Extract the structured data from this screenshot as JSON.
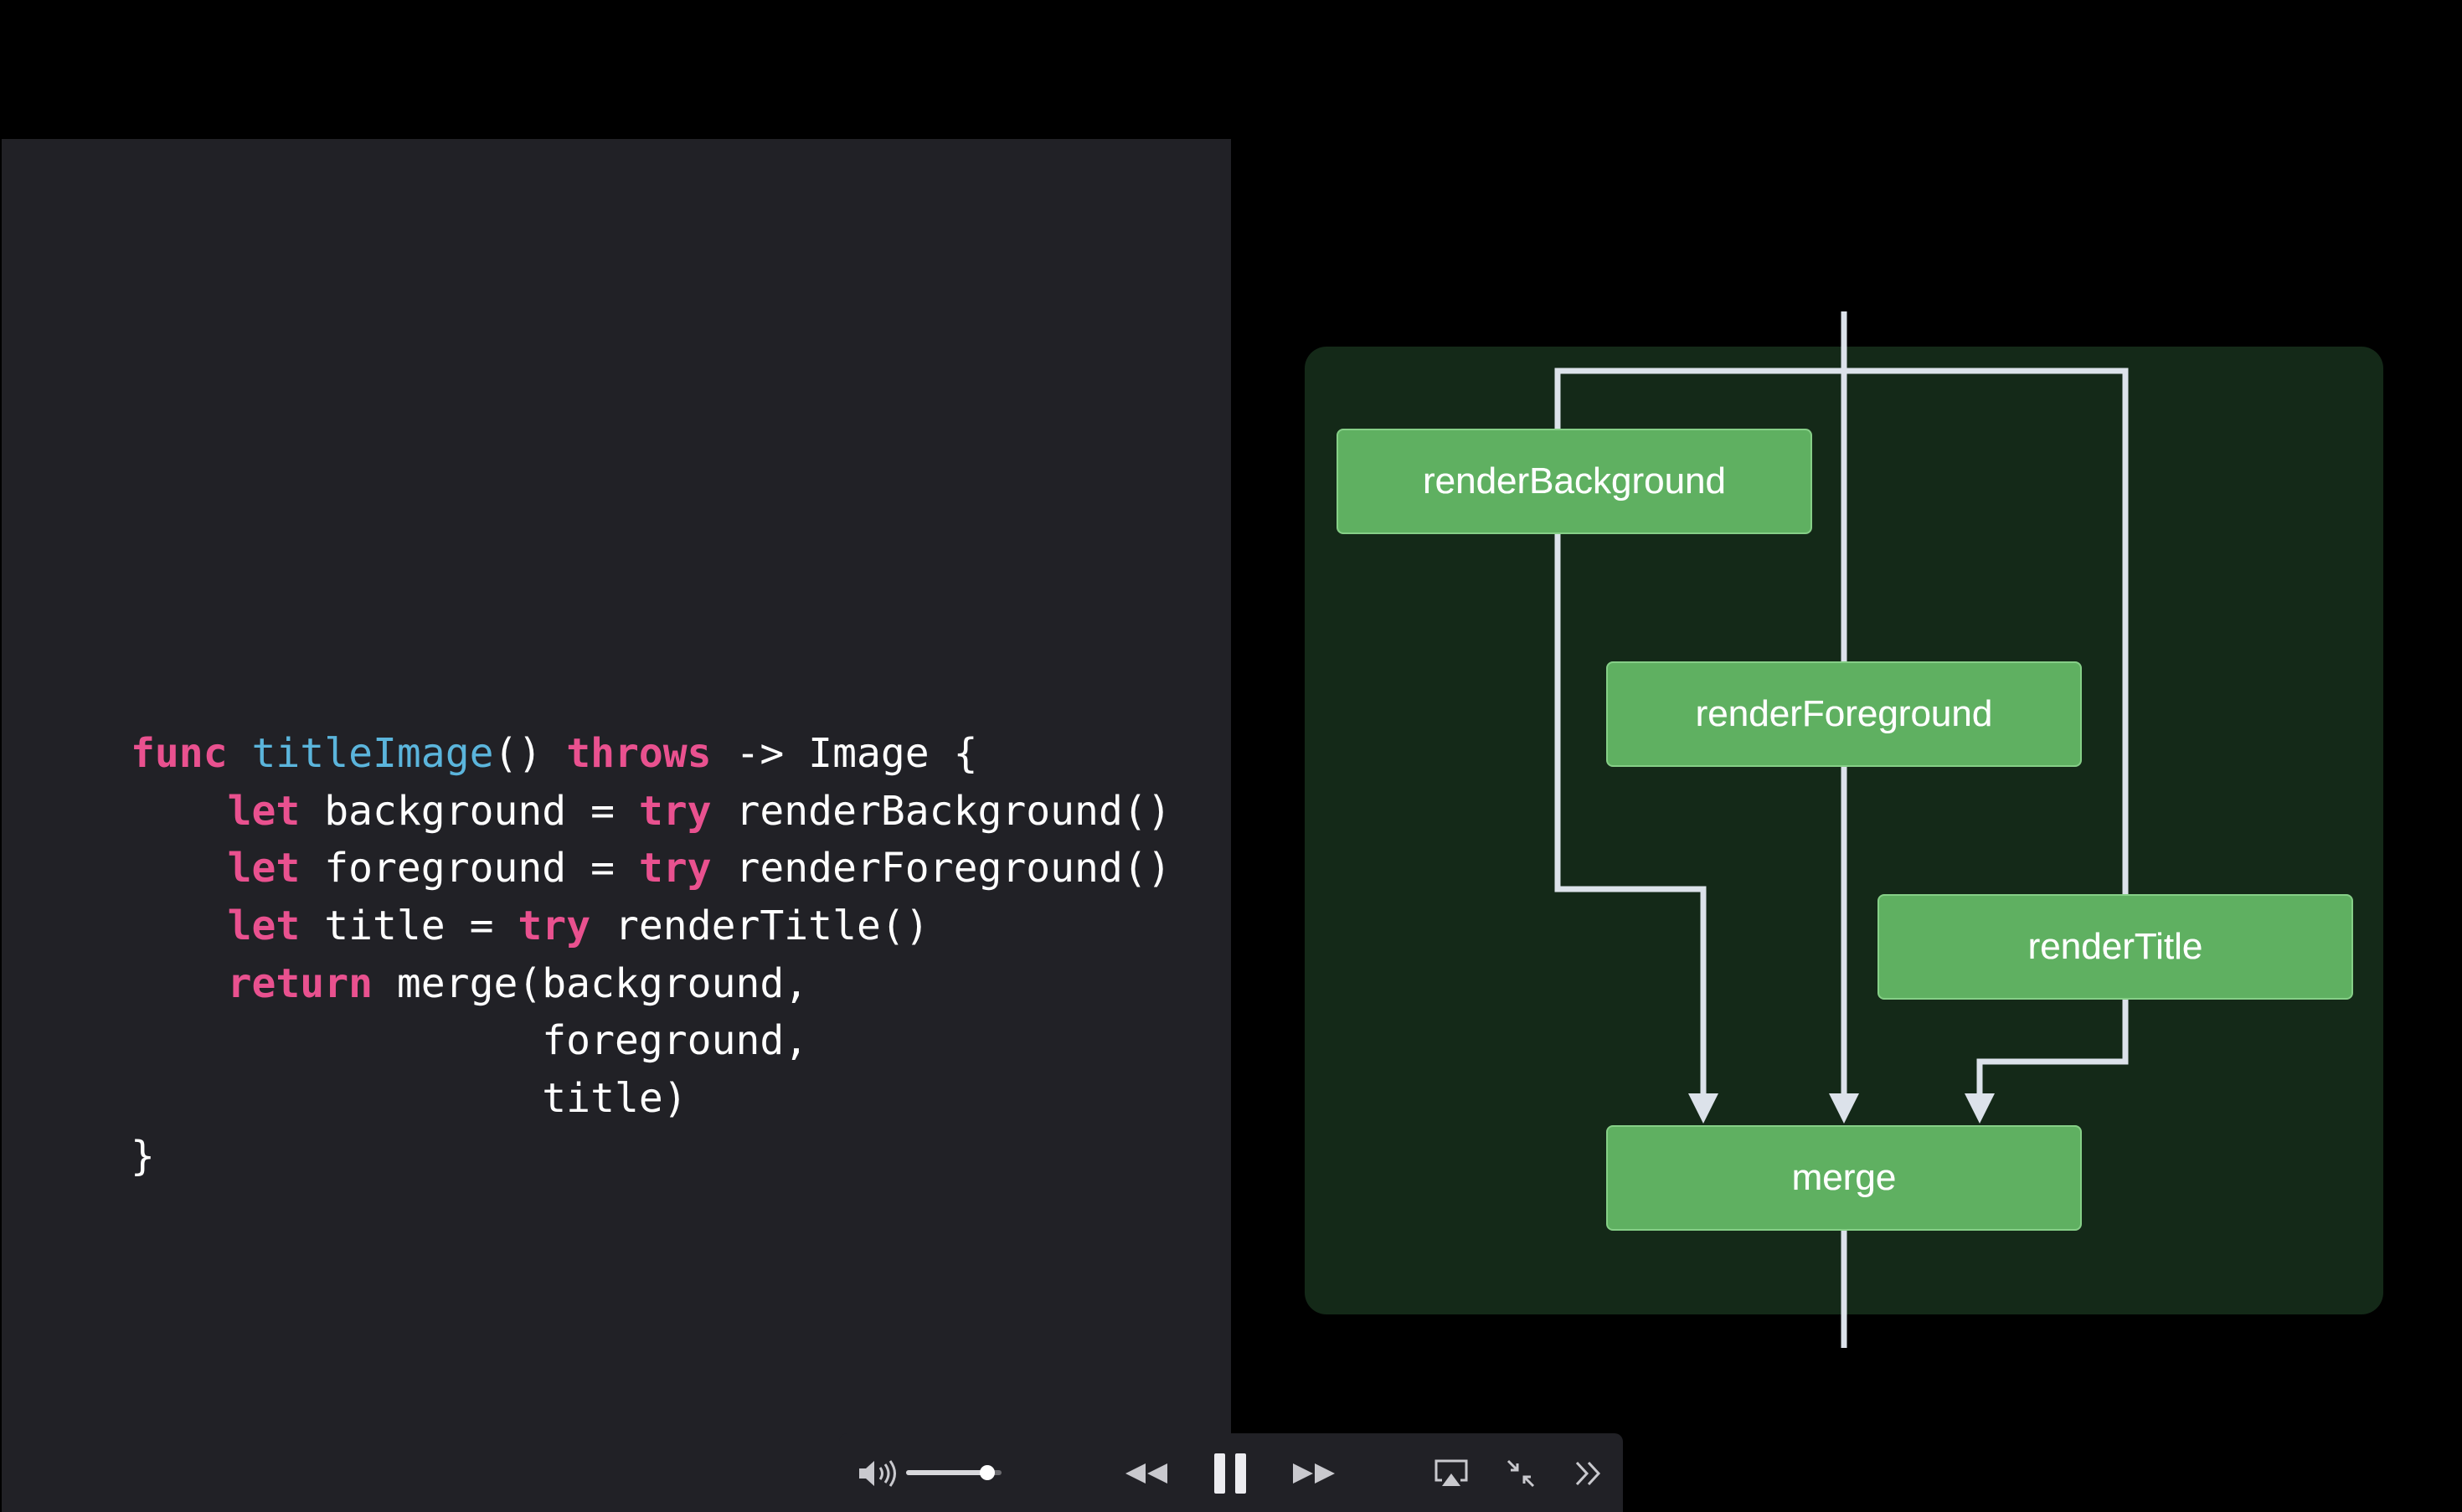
{
  "code": {
    "lines": [
      [
        {
          "t": "func",
          "k": "kw"
        },
        {
          "t": " ",
          "k": "plain"
        },
        {
          "t": "titleImage",
          "k": "fn"
        },
        {
          "t": "() ",
          "k": "plain"
        },
        {
          "t": "throws",
          "k": "kw"
        },
        {
          "t": " -> Image {",
          "k": "plain"
        }
      ],
      [
        {
          "t": "    ",
          "k": "plain"
        },
        {
          "t": "let",
          "k": "kw"
        },
        {
          "t": " background = ",
          "k": "plain"
        },
        {
          "t": "try",
          "k": "kw"
        },
        {
          "t": " renderBackground()",
          "k": "plain"
        }
      ],
      [
        {
          "t": "    ",
          "k": "plain"
        },
        {
          "t": "let",
          "k": "kw"
        },
        {
          "t": " foreground = ",
          "k": "plain"
        },
        {
          "t": "try",
          "k": "kw"
        },
        {
          "t": " renderForeground()",
          "k": "plain"
        }
      ],
      [
        {
          "t": "    ",
          "k": "plain"
        },
        {
          "t": "let",
          "k": "kw"
        },
        {
          "t": " title = ",
          "k": "plain"
        },
        {
          "t": "try",
          "k": "kw"
        },
        {
          "t": " renderTitle()",
          "k": "plain"
        }
      ],
      [
        {
          "t": "    ",
          "k": "plain"
        },
        {
          "t": "return",
          "k": "kw"
        },
        {
          "t": " merge(background,",
          "k": "plain"
        }
      ],
      [
        {
          "t": "                 foreground,",
          "k": "plain"
        }
      ],
      [
        {
          "t": "                 title)",
          "k": "plain"
        }
      ],
      [
        {
          "t": "}",
          "k": "plain"
        }
      ]
    ]
  },
  "diagram": {
    "nodes": {
      "render_background": "renderBackground",
      "render_foreground": "renderForeground",
      "render_title": "renderTitle",
      "merge": "merge"
    }
  },
  "colors": {
    "keyword": "#e9518f",
    "function_name": "#5bb5dc",
    "node_fill": "#5fb061",
    "diagram_background": "#142918",
    "wire": "#dce2ea"
  },
  "player": {
    "volume_level": 0.85,
    "state": "playing",
    "icons": [
      "volume-icon",
      "rewind-icon",
      "pause-icon",
      "fast-forward-icon",
      "airplay-icon",
      "exit-fullscreen-icon",
      "more-icon"
    ]
  }
}
